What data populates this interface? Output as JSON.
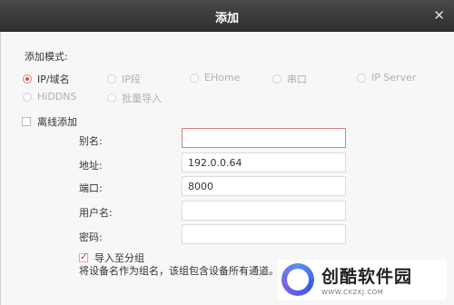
{
  "dialog": {
    "title": "添加",
    "close_glyph": "✕"
  },
  "add_mode": {
    "label": "添加模式:",
    "options": [
      {
        "label": "IP/域名",
        "checked": true
      },
      {
        "label": "IP段",
        "checked": false
      },
      {
        "label": "EHome",
        "checked": false
      },
      {
        "label": "串口",
        "checked": false
      },
      {
        "label": "IP Server",
        "checked": false
      },
      {
        "label": "HiDDNS",
        "checked": false
      },
      {
        "label": "批量导入",
        "checked": false
      }
    ]
  },
  "offline_add": {
    "label": "离线添加",
    "checked": false
  },
  "fields": {
    "alias": {
      "label": "别名:",
      "value": ""
    },
    "address": {
      "label": "地址:",
      "value": "192.0.0.64"
    },
    "port": {
      "label": "端口:",
      "value": "8000"
    },
    "username": {
      "label": "用户名:",
      "value": ""
    },
    "password": {
      "label": "密码:",
      "value": ""
    }
  },
  "import_to_group": {
    "label": "导入至分组",
    "checked": true
  },
  "note": "将设备名作为组名，该组包含设备所有通道。",
  "watermark": {
    "name": "创酷软件园",
    "url": "WWW.CKZKJ.COM"
  }
}
